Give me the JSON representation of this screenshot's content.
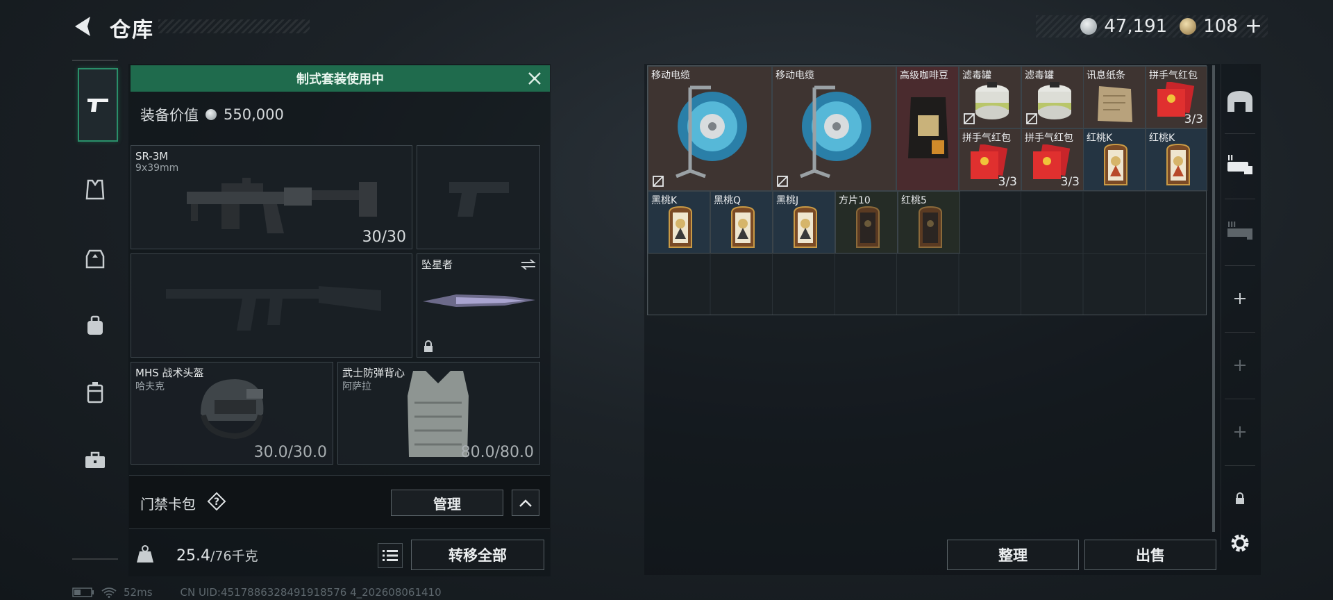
{
  "header": {
    "title": "仓库",
    "currencies": [
      {
        "name": "silver-coin",
        "value": "47,191",
        "color": "#b9bfc3"
      },
      {
        "name": "gold-token",
        "value": "108",
        "color": "#c9a86a"
      }
    ],
    "plus": "+"
  },
  "left_nav": [
    {
      "id": "weapons",
      "icon": "pistol-icon",
      "active": true
    },
    {
      "id": "armor",
      "icon": "vest-icon",
      "active": false
    },
    {
      "id": "rig",
      "icon": "chest-rig-icon",
      "active": false
    },
    {
      "id": "backpack",
      "icon": "backpack-icon",
      "active": false
    },
    {
      "id": "pouch",
      "icon": "pouch-icon",
      "active": false
    },
    {
      "id": "case",
      "icon": "briefcase-icon",
      "active": false
    }
  ],
  "loadout": {
    "kit_banner": "制式套装使用中",
    "equip_value_label": "装备价值",
    "equip_value": "550,000",
    "slots": {
      "primary": {
        "name": "SR-3M",
        "caliber": "9x39mm",
        "count": "30/30"
      },
      "melee": {
        "name": "坠星者"
      },
      "helmet": {
        "name": "MHS 战术头盔",
        "sub": "哈夫克",
        "durability": "30.0/30.0"
      },
      "armor": {
        "name": "武士防弹背心",
        "sub": "阿萨拉",
        "durability": "80.0/80.0"
      }
    },
    "keycard_label": "门禁卡包",
    "help": "?",
    "manage": "管理",
    "weight_current": "25.4",
    "weight_max": "/76千克",
    "transfer_all": "转移全部"
  },
  "storage": {
    "items": [
      {
        "name": "移动电缆",
        "color": "brown",
        "icon": "cable-reel-icon"
      },
      {
        "name": "移动电缆",
        "color": "brown",
        "icon": "cable-reel-icon"
      },
      {
        "name": "高级咖啡豆",
        "color": "red",
        "icon": "coffee-bag-icon"
      },
      {
        "name": "滤毒罐",
        "color": "brown",
        "icon": "gas-filter-icon"
      },
      {
        "name": "滤毒罐",
        "color": "brown",
        "icon": "gas-filter-icon"
      },
      {
        "name": "讯息纸条",
        "color": "brown",
        "icon": "paper-note-icon"
      },
      {
        "name": "拼手气红包",
        "color": "brown",
        "count": "3/3",
        "icon": "red-envelope-icon"
      },
      {
        "name": "拼手气红包",
        "color": "brown",
        "count": "3/3",
        "icon": "red-envelope-icon"
      },
      {
        "name": "拼手气红包",
        "color": "brown",
        "count": "3/3",
        "icon": "red-envelope-icon"
      },
      {
        "name": "红桃K",
        "color": "blue",
        "icon": "playing-card-icon"
      },
      {
        "name": "红桃K",
        "color": "blue",
        "icon": "playing-card-icon"
      },
      {
        "name": "黑桃K",
        "color": "blue",
        "icon": "playing-card-icon"
      },
      {
        "name": "黑桃Q",
        "color": "blue",
        "icon": "playing-card-icon"
      },
      {
        "name": "黑桃J",
        "color": "blue",
        "icon": "playing-card-icon"
      },
      {
        "name": "方片10",
        "color": "green",
        "icon": "playing-card-icon"
      },
      {
        "name": "红桃5",
        "color": "green",
        "icon": "playing-card-icon"
      }
    ],
    "sort": "整理",
    "sell": "出售"
  },
  "status": {
    "ping": "52ms",
    "uid": "CN UID:4517886328491918576 4_202608061410"
  }
}
